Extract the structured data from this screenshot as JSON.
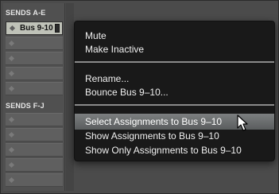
{
  "sends_panel": {
    "header_a_e": "SENDS A-E",
    "header_f_j": "SENDS F-J",
    "assigned_send": "Bus 9-10"
  },
  "context_menu": {
    "mute": "Mute",
    "make_inactive": "Make Inactive",
    "rename": "Rename...",
    "bounce": "Bounce Bus 9–10...",
    "select_assignments": "Select Assignments to Bus 9–10",
    "show_assignments": "Show Assignments to Bus 9–10",
    "show_only_assignments": "Show Only Assignments to Bus 9–10",
    "highlighted_item": "Select Assignments to Bus 9–10"
  },
  "colors": {
    "menu_background": "#161616",
    "highlight": "#6e7172",
    "assigned_slot": "#bfc2b8"
  },
  "icons": {
    "slot_marker": "diamond-icon",
    "pointer": "arrow-cursor-icon"
  }
}
